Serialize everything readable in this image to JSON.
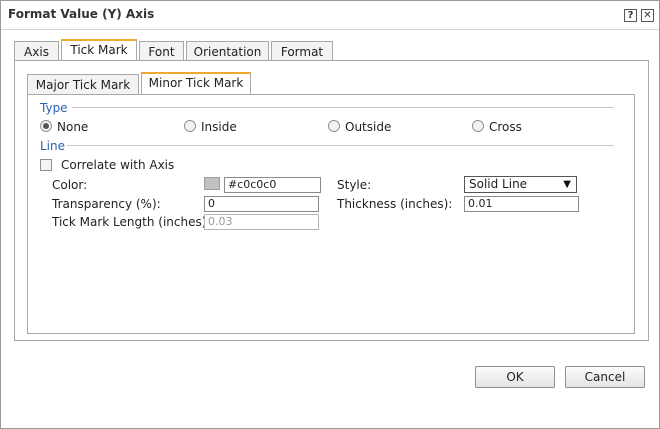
{
  "dialog": {
    "title": "Format Value (Y) Axis",
    "help_glyph": "?",
    "close_glyph": "✕"
  },
  "tabs": [
    {
      "label": "Axis"
    },
    {
      "label": "Tick Mark"
    },
    {
      "label": "Font"
    },
    {
      "label": "Orientation"
    },
    {
      "label": "Format"
    }
  ],
  "active_tab": "Tick Mark",
  "subtabs": [
    {
      "label": "Major Tick Mark"
    },
    {
      "label": "Minor Tick Mark"
    }
  ],
  "active_subtab": "Minor Tick Mark",
  "type_section": {
    "legend": "Type",
    "options": [
      {
        "label": "None",
        "checked": true
      },
      {
        "label": "Inside",
        "checked": false
      },
      {
        "label": "Outside",
        "checked": false
      },
      {
        "label": "Cross",
        "checked": false
      }
    ]
  },
  "line_section": {
    "legend": "Line",
    "correlate_label": "Correlate with Axis",
    "correlate_checked": false,
    "color_label": "Color:",
    "color_value": "#c0c0c0",
    "style_label": "Style:",
    "style_value": "Solid Line",
    "transparency_label": "Transparency (%):",
    "transparency_value": "0",
    "thickness_label": "Thickness (inches):",
    "thickness_value": "0.01",
    "tick_length_label": "Tick Mark Length (inches):",
    "tick_length_value": "0.03"
  },
  "buttons": {
    "ok": "OK",
    "cancel": "Cancel"
  },
  "colors": {
    "active_tab_accent": "#f0a830",
    "legend_text": "#2b62b8",
    "swatch": "#c0c0c0"
  }
}
